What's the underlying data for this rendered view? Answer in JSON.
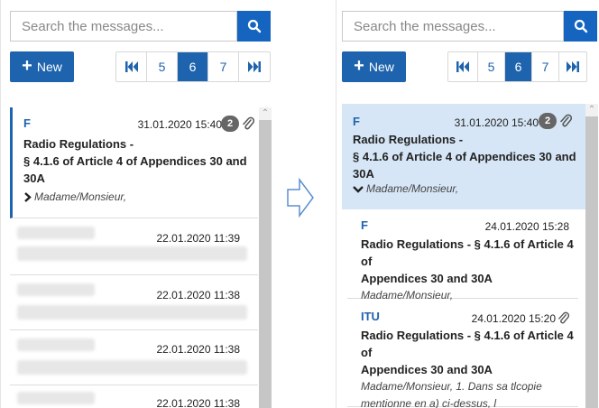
{
  "search": {
    "placeholder": "Search the messages..."
  },
  "toolbar": {
    "new_label": "New"
  },
  "pager": {
    "pages": [
      "5",
      "6",
      "7"
    ],
    "active": "6"
  },
  "left": {
    "selected": {
      "from": "F",
      "date": "31.01.2020 15:40",
      "count": "2",
      "subject_lines": [
        "Radio Regulations -",
        "§ 4.1.6 of Article 4 of Appendices 30 and",
        "30A"
      ],
      "preview": "Madame/Monsieur,"
    },
    "redacted_dates": [
      "22.01.2020 11:39",
      "22.01.2020 11:38",
      "22.01.2020 11:38",
      "22.01.2020 11:38"
    ]
  },
  "right": {
    "selected": {
      "from": "F",
      "date": "31.01.2020 15:40",
      "count": "2",
      "subject_lines": [
        "Radio Regulations -",
        "§ 4.1.6 of Article 4 of Appendices 30 and",
        "30A"
      ],
      "preview": "Madame/Monsieur,"
    },
    "replies": [
      {
        "from": "F",
        "date": "24.01.2020 15:28",
        "subject_lines": [
          "Radio Regulations - § 4.1.6 of Article 4 of",
          "Appendices 30 and 30A"
        ],
        "preview_lines": [
          "Madame/Monsieur,"
        ]
      },
      {
        "from": "ITU",
        "date": "24.01.2020 15:20",
        "subject_lines": [
          "Radio Regulations - § 4.1.6 of Article 4 of",
          "Appendices 30 and 30A"
        ],
        "preview_lines": [
          "Madame/Monsieur, 1. Dans sa tlcopie",
          "mentionne en a) ci-dessus, l"
        ]
      }
    ]
  },
  "colors": {
    "accent": "#1e63ad",
    "selected_bg": "#d6e6f6",
    "badge": "#666666"
  }
}
